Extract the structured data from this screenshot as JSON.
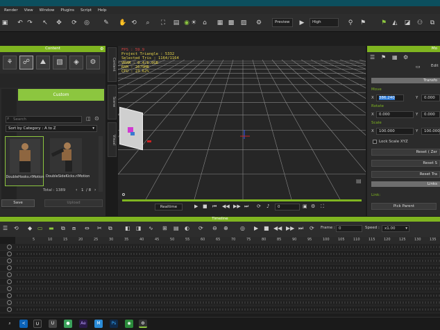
{
  "menu": [
    "Render",
    "View",
    "Window",
    "Plugins",
    "Script",
    "Help"
  ],
  "toolbar": {
    "preview_label": "Preview",
    "quality_label": "High"
  },
  "content_panel": {
    "title": "Content",
    "custom_label": "Custom",
    "search_placeholder": "Search",
    "sort_label": "Sort by Category : A to Z",
    "items": [
      {
        "name": "DoubleHooks.rlMotion"
      },
      {
        "name": "DoubleSideKicks.rlMotion"
      }
    ],
    "total_label": "Total : 1389",
    "page": "1",
    "pages": "/ 8",
    "save_label": "Save",
    "upload_label": "Upload"
  },
  "side_tabs": [
    "Content",
    "Scene",
    "Visual"
  ],
  "viewport_stats": [
    "FPS : 59.9",
    "Project Triangle : 5332",
    "Selected Tris : 1164/1164",
    "VRAM : 0.4/6.0GB",
    "RAM : 2679MB",
    "CPU : 23.62%"
  ],
  "playback": {
    "mode_label": "Realtime",
    "frame_value": "0"
  },
  "modify_panel": {
    "title": "Mo",
    "edit_label": "Edit",
    "transform_label": "Transfo",
    "move_label": "Move",
    "rotate_label": "Rotate",
    "scale_label": "Scale",
    "move_x": "386.240",
    "move_y": "0.000",
    "rot_x": "0.000",
    "rot_y": "0.000",
    "scale_x": "100.000",
    "scale_y": "100.000",
    "lock_scale_label": "Lock Scale XYZ",
    "reset_z_label": "Reset ( Zer",
    "reset_s_label": "Reset S",
    "reset_tr_label": "Reset Tra",
    "link_label": "Links",
    "link_field_label": "Link:",
    "pick_parent_label": "Pick Parent"
  },
  "timeline": {
    "title": "Timeline",
    "frame_label": "Frame :",
    "frame_value": "0",
    "speed_label": "Speed :",
    "speed_value": "x1.00",
    "ruler": [
      "5",
      "10",
      "15",
      "20",
      "25",
      "30",
      "35",
      "40",
      "45",
      "50",
      "55",
      "60",
      "65",
      "70",
      "75",
      "80",
      "85",
      "90",
      "95",
      "100",
      "105",
      "110",
      "115",
      "120",
      "125",
      "130",
      "135"
    ]
  },
  "colors": {
    "accent": "#8cc63f",
    "title_bar": "#0c4f5e",
    "stats": "#e8d54a"
  }
}
